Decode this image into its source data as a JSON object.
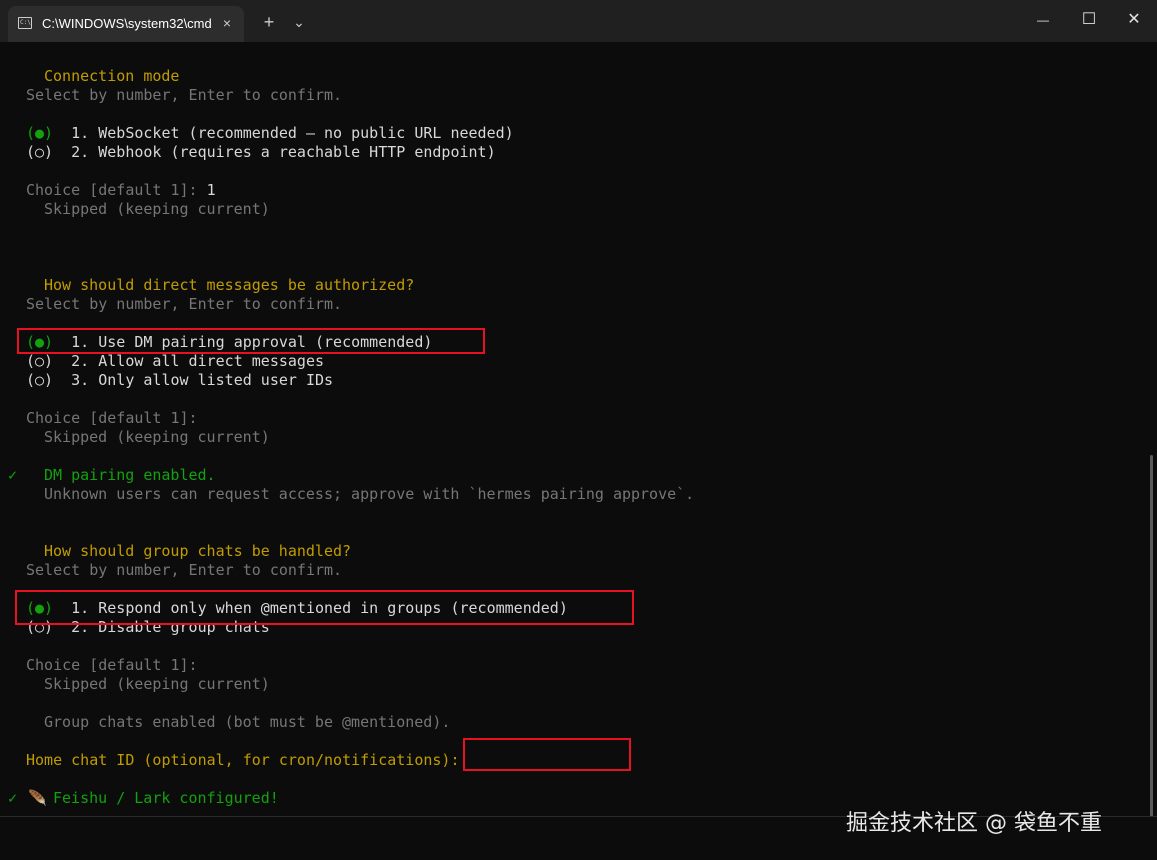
{
  "window": {
    "tab_title": "C:\\WINDOWS\\system32\\cmd.",
    "tab_close": "×",
    "new_tab": "+",
    "dropdown": "⌄",
    "minimize": "—",
    "maximize": "☐",
    "close": "✕"
  },
  "terminal": {
    "connection_mode": {
      "heading": "Connection mode",
      "hint": "Select by number, Enter to confirm.",
      "options": [
        {
          "marker": "(●)",
          "text": "1. WebSocket (recommended — no public URL needed)"
        },
        {
          "marker": "(○)",
          "text": "2. Webhook (requires a reachable HTTP endpoint)"
        }
      ],
      "choice_prompt": "Choice [default 1]:",
      "choice_value": "1",
      "skipped": "Skipped (keeping current)"
    },
    "dm_auth": {
      "heading": "How should direct messages be authorized?",
      "hint": "Select by number, Enter to confirm.",
      "options": [
        {
          "marker": "(●)",
          "text": "1. Use DM pairing approval (recommended)"
        },
        {
          "marker": "(○)",
          "text": "2. Allow all direct messages"
        },
        {
          "marker": "(○)",
          "text": "3. Only allow listed user IDs"
        }
      ],
      "choice_prompt": "Choice [default 1]:",
      "skipped": "Skipped (keeping current)",
      "result_check": "✓",
      "result": "DM pairing enabled.",
      "result_note": "Unknown users can request access; approve with `hermes pairing approve`."
    },
    "group_chats": {
      "heading": "How should group chats be handled?",
      "hint": "Select by number, Enter to confirm.",
      "options": [
        {
          "marker": "(●)",
          "text": "1. Respond only when @mentioned in groups (recommended)"
        },
        {
          "marker": "(○)",
          "text": "2. Disable group chats"
        }
      ],
      "choice_prompt": "Choice [default 1]:",
      "skipped": "Skipped (keeping current)",
      "status": "Group chats enabled (bot must be @mentioned)."
    },
    "home_chat_prompt": "Home chat ID (optional, for cron/notifications):",
    "final_check": "✓",
    "final_icon": "🪶",
    "final_message": "Feishu / Lark configured!"
  },
  "watermark": "掘金技术社区 @ 袋鱼不重",
  "colors": {
    "heading": "#c19c00",
    "dim": "#767676",
    "selected": "#13a10e",
    "highlight_box": "#e81123",
    "background": "#0c0c0c"
  }
}
